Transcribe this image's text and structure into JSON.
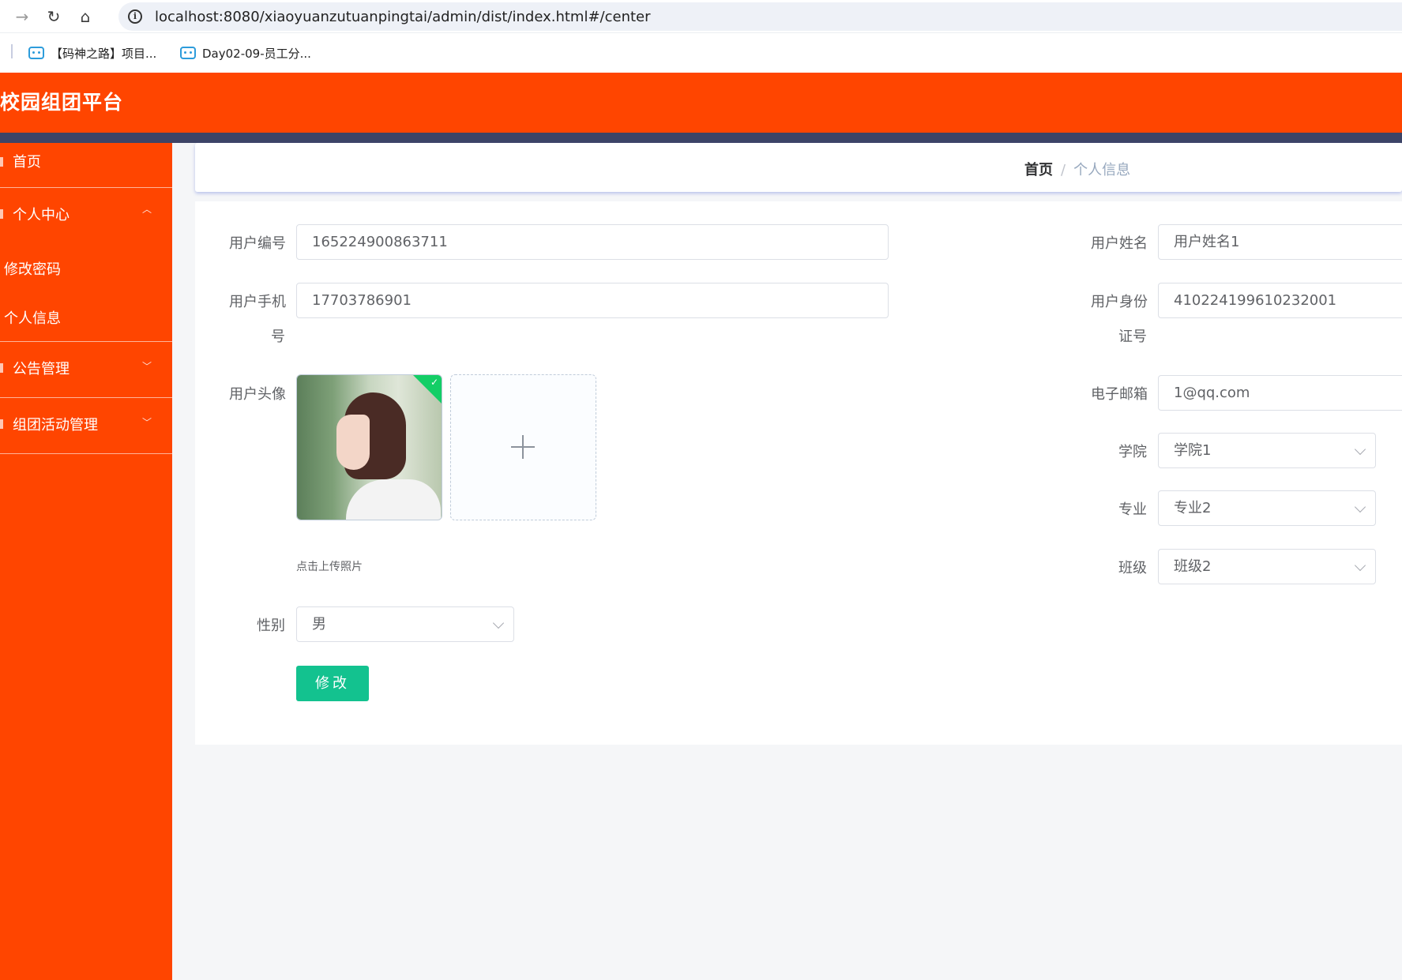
{
  "browser": {
    "url": "localhost:8080/xiaoyuanzutuanpingtai/admin/dist/index.html#/center",
    "bookmarks": [
      {
        "label": "【码神之路】项目...",
        "icon": "bilibili-icon"
      },
      {
        "label": "Day02-09-员工分...",
        "icon": "bilibili-icon"
      }
    ]
  },
  "app": {
    "title": "校园组团平台",
    "brand_color": "#ff4500"
  },
  "sidebar": {
    "home": "首页",
    "personal_center": "个人中心",
    "change_password": "修改密码",
    "personal_info": "个人信息",
    "notice_management": "公告管理",
    "activity_management": "组团活动管理"
  },
  "breadcrumb": {
    "home": "首页",
    "separator": "/",
    "current": "个人信息"
  },
  "form": {
    "user_id_label": "用户编号",
    "user_id_value": "165224900863711",
    "user_name_label": "用户姓名",
    "user_name_value": "用户姓名1",
    "phone_label_line1": "用户手机",
    "phone_label_line2": "号",
    "phone_value": "17703786901",
    "id_card_label_line1": "用户身份",
    "id_card_label_line2": "证号",
    "id_card_value": "410224199610232001",
    "avatar_label": "用户头像",
    "upload_tip": "点击上传照片",
    "email_label": "电子邮箱",
    "email_value": "1@qq.com",
    "college_label": "学院",
    "college_value": "学院1",
    "major_label": "专业",
    "major_value": "专业2",
    "class_label": "班级",
    "class_value": "班级2",
    "gender_label": "性别",
    "gender_value": "男",
    "submit_label": "修改"
  }
}
